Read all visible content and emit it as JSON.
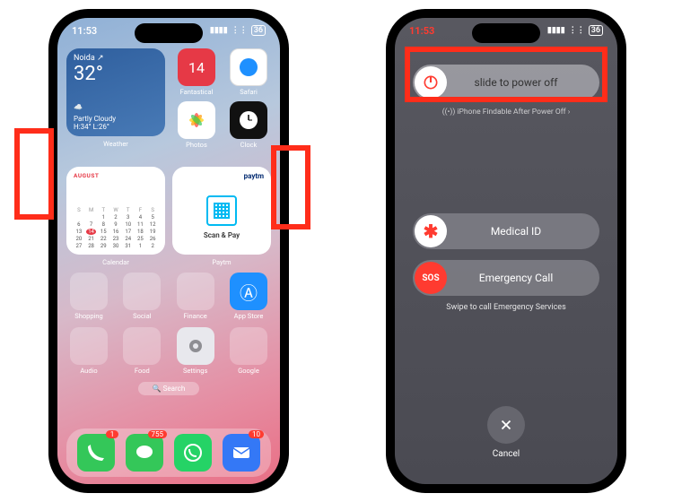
{
  "status": {
    "time": "11:53",
    "signal": "▮▮▮▮",
    "wifi": "⋮⋮",
    "battery_level": "36"
  },
  "weather": {
    "city": "Noida",
    "arrow": "↗",
    "temp": "32°",
    "icon": "☁️",
    "condition": "Partly Cloudy",
    "hi_lo": "H:34° L:26°",
    "label": "Weather"
  },
  "apps_row1": {
    "fantastical": "Fantastical",
    "safari": "Safari"
  },
  "apps_row2": {
    "photos": "Photos",
    "clock": "Clock"
  },
  "calendar": {
    "month": "AUGUST",
    "dow": [
      "S",
      "M",
      "T",
      "W",
      "T",
      "F",
      "S"
    ],
    "cells": [
      "",
      "",
      "1",
      "2",
      "3",
      "4",
      "5",
      "6",
      "7",
      "8",
      "9",
      "10",
      "11",
      "12",
      "13",
      "14",
      "15",
      "16",
      "17",
      "18",
      "19",
      "20",
      "21",
      "22",
      "23",
      "24",
      "25",
      "26",
      "27",
      "28",
      "29",
      "30",
      "31",
      "1",
      "2"
    ],
    "today": "14",
    "label": "Calendar"
  },
  "paytm": {
    "brand": "paytm",
    "action": "Scan & Pay",
    "label": "Paytm"
  },
  "row_small_1": {
    "shopping": "Shopping",
    "social": "Social",
    "finance": "Finance",
    "appstore": "App Store"
  },
  "row_small_2": {
    "audio": "Audio",
    "food": "Food",
    "settings": "Settings",
    "google": "Google"
  },
  "search": "🔍 Search",
  "dock": {
    "phone_badge": "1",
    "messages_badge": "755",
    "whatsapp_badge": "",
    "mail_badge": "10"
  },
  "poweroff": {
    "slide_label": "slide to power off",
    "findable": "((•)) iPhone Findable After Power Off ›",
    "medical": "Medical ID",
    "sos": "Emergency Call",
    "sos_knob": "SOS",
    "swipe_note": "Swipe to call Emergency Services",
    "cancel": "Cancel"
  }
}
